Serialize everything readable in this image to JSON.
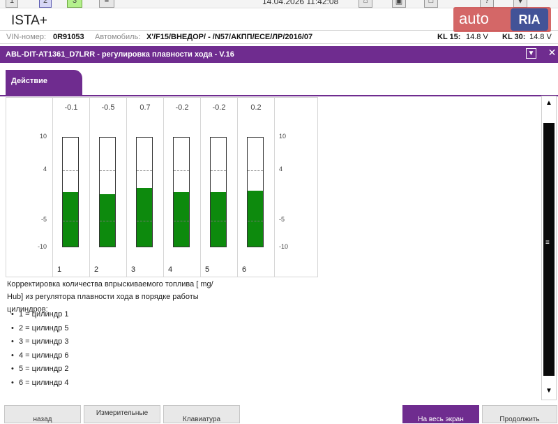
{
  "topbar": {
    "buttons": [
      "1",
      "2",
      "3"
    ],
    "datetime": "14.04.2026 11:42:08"
  },
  "app": {
    "title": "ISTA+"
  },
  "info": {
    "vin_label": "VIN-номер:",
    "vin_value": "0R91053",
    "car_label": "Автомобиль:",
    "car_value": "X'/F15/ВНЕДОР/ - /N57/АКПП/ECE/ЛР/2016/07",
    "kl15_label": "KL 15:",
    "kl15_value": "14.8 V",
    "kl30_label": "KL 30:",
    "kl30_value": "14.8 V"
  },
  "window": {
    "title": "ABL-DIT-AT1361_D7LRR - регулировка плавности хода - V.16",
    "menu_icon": "dropdown-icon",
    "close_icon": "close-icon"
  },
  "tab": {
    "label": "Действие"
  },
  "chart_data": {
    "type": "bar",
    "categories": [
      "1",
      "2",
      "3",
      "4",
      "5",
      "6"
    ],
    "values": [
      -0.1,
      -0.5,
      0.7,
      -0.2,
      -0.2,
      0.2
    ],
    "value_labels": [
      "-0.1",
      "-0.5",
      "0.7",
      "-0.2",
      "-0.2",
      "0.2"
    ],
    "ylim": [
      -10,
      10
    ],
    "yticks": [
      "10",
      "4",
      "-5",
      "-10"
    ],
    "thresholds": [
      4,
      -5
    ],
    "bar_color": "#0d8a0d"
  },
  "description": {
    "line1": "Корректировка количества впрыскиваемого топлива [ mg/",
    "line2": "Hub] из регулятора плавности хода в порядке работы",
    "line3": "цилиндров:",
    "mapping": [
      "1 = цилиндр 1",
      "2 = цилиндр 5",
      "3 = цилиндр 3",
      "4 = цилиндр 6",
      "5 = цилиндр 2",
      "6 = цилиндр 4"
    ]
  },
  "buttons": {
    "back": "назад",
    "measured": "Измерительные",
    "keyboard": "Клавиатура",
    "fullscreen": "На весь экран",
    "continue": "Продолжить"
  },
  "watermark": {
    "left": "auto",
    "right": "RIA"
  },
  "colors": {
    "accent": "#6f2c8f",
    "bar": "#0d8a0d"
  }
}
